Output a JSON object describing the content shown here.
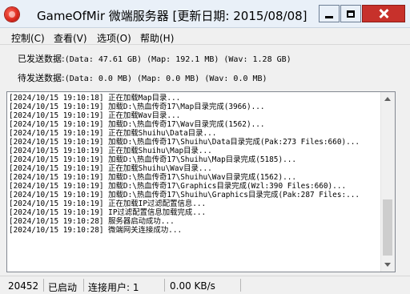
{
  "window": {
    "title": "GameOfMir 微端服务器 [更新日期: 2015/08/08]",
    "icon": "red-orb-icon"
  },
  "menu": {
    "items": [
      "控制(C)",
      "查看(V)",
      "选项(O)",
      "帮助(H)"
    ]
  },
  "stats": {
    "sent_label": "已发送数据:",
    "sent_value": "(Data: 47.61 GB) (Map: 192.1 MB) (Wav: 1.28 GB)",
    "pending_label": "待发送数据:",
    "pending_value": "(Data: 0.0 MB) (Map: 0.0 MB) (Wav: 0.0 MB)"
  },
  "log": {
    "lines": [
      "[2024/10/15 19:10:18] 正在加载Map目录...",
      "[2024/10/15 19:10:19] 加载D:\\热血传奇17\\Map目录完成(3966)...",
      "[2024/10/15 19:10:19] 正在加载Wav目录...",
      "[2024/10/15 19:10:19] 加载D:\\热血传奇17\\Wav目录完成(1562)...",
      "[2024/10/15 19:10:19] 正在加载Shuihu\\Data目录...",
      "[2024/10/15 19:10:19] 加载D:\\热血传奇17\\Shuihu\\Data目录完成(Pak:273 Files:660)...",
      "[2024/10/15 19:10:19] 正在加载Shuihu\\Map目录...",
      "[2024/10/15 19:10:19] 加载D:\\热血传奇17\\Shuihu\\Map目录完成(5185)...",
      "[2024/10/15 19:10:19] 正在加载Shuihu\\Wav目录...",
      "[2024/10/15 19:10:19] 加载D:\\热血传奇17\\Shuihu\\Wav目录完成(1562)...",
      "[2024/10/15 19:10:19] 加载D:\\热血传奇17\\Graphics目录完成(Wzl:390 Files:660)...",
      "[2024/10/15 19:10:19] 加载D:\\热血传奇17\\Shuihu\\Graphics目录完成(Pak:287 Files:...",
      "[2024/10/15 19:10:19] 正在加载IP过滤配置信息...",
      "[2024/10/15 19:10:19] IP过滤配置信息加载完成...",
      "[2024/10/15 19:10:28] 服务器启动成功...",
      "[2024/10/15 19:10:28] 微端网关连接成功..."
    ]
  },
  "status": {
    "port": "20452",
    "state": "已启动",
    "users": "连接用户: 1",
    "speed": "0.00 KB/s"
  }
}
